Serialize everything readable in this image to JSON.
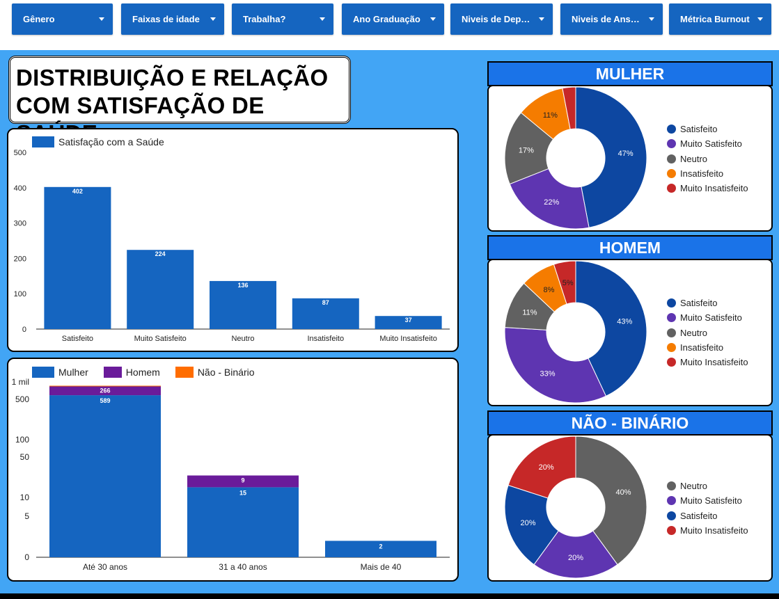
{
  "filters": [
    {
      "label": "Gênero"
    },
    {
      "label": "Faixas de idade"
    },
    {
      "label": "Trabalha?"
    },
    {
      "label": "Ano Graduação"
    },
    {
      "label": "Niveis de Depressão"
    },
    {
      "label": "Niveis de Ansiedade"
    },
    {
      "label": "Métrica Burnout"
    }
  ],
  "title": "DISTRIBUIÇÃO E RELAÇÃO COM SATISFAÇÃO DE SAÚDE",
  "colors": {
    "bar_blue": "#1565c0",
    "homem_purple": "#6a1b9a",
    "nb_orange": "#ff6d00",
    "satisfeito": "#0d47a1",
    "muito_satisfeito": "#5e35b1",
    "neutro": "#616161",
    "insatisfeito": "#f57c00",
    "muito_insatisfeito": "#c62828"
  },
  "chart_data": [
    {
      "type": "bar",
      "legend": "Satisfação com a Saúde",
      "categories": [
        "Satisfeito",
        "Muito Satisfeito",
        "Neutro",
        "Insatisfeito",
        "Muito Insatisfeito"
      ],
      "values": [
        402,
        224,
        136,
        87,
        37
      ],
      "ylim": [
        0,
        500
      ],
      "yticks": [
        "0",
        "100",
        "200",
        "300",
        "400",
        "500"
      ]
    },
    {
      "type": "bar",
      "stacked": true,
      "scale": "log",
      "categories": [
        "Até 30 anos",
        "31 a 40 anos",
        "Mais de 40"
      ],
      "series": [
        {
          "name": "Mulher",
          "values": [
            589,
            15,
            2
          ]
        },
        {
          "name": "Homem",
          "values": [
            266,
            9,
            0
          ]
        },
        {
          "name": "Não - Binário",
          "values": [
            5,
            0,
            0
          ]
        }
      ],
      "yticks": [
        "0",
        "5",
        "10",
        "50",
        "100",
        "500",
        "1 mil"
      ]
    },
    {
      "type": "pie",
      "title": "MULHER",
      "slices": [
        {
          "label": "Satisfeito",
          "value": 47,
          "text": "47%"
        },
        {
          "label": "Muito Satisfeito",
          "value": 22,
          "text": "22%"
        },
        {
          "label": "Neutro",
          "value": 17,
          "text": "17%"
        },
        {
          "label": "Insatisfeito",
          "value": 11,
          "text": "11%"
        },
        {
          "label": "Muito Insatisfeito",
          "value": 3,
          "text": ""
        }
      ]
    },
    {
      "type": "pie",
      "title": "HOMEM",
      "slices": [
        {
          "label": "Satisfeito",
          "value": 43,
          "text": "43%"
        },
        {
          "label": "Muito Satisfeito",
          "value": 33,
          "text": "33%"
        },
        {
          "label": "Neutro",
          "value": 11,
          "text": "11%"
        },
        {
          "label": "Insatisfeito",
          "value": 8,
          "text": "8%"
        },
        {
          "label": "Muito Insatisfeito",
          "value": 5,
          "text": "5%"
        }
      ]
    },
    {
      "type": "pie",
      "title": "NÃO - BINÁRIO",
      "slices": [
        {
          "label": "Neutro",
          "value": 40,
          "text": "40%"
        },
        {
          "label": "Muito Satisfeito",
          "value": 20,
          "text": "20%"
        },
        {
          "label": "Satisfeito",
          "value": 20,
          "text": "20%"
        },
        {
          "label": "Muito Insatisfeito",
          "value": 20,
          "text": "20%"
        }
      ]
    }
  ]
}
